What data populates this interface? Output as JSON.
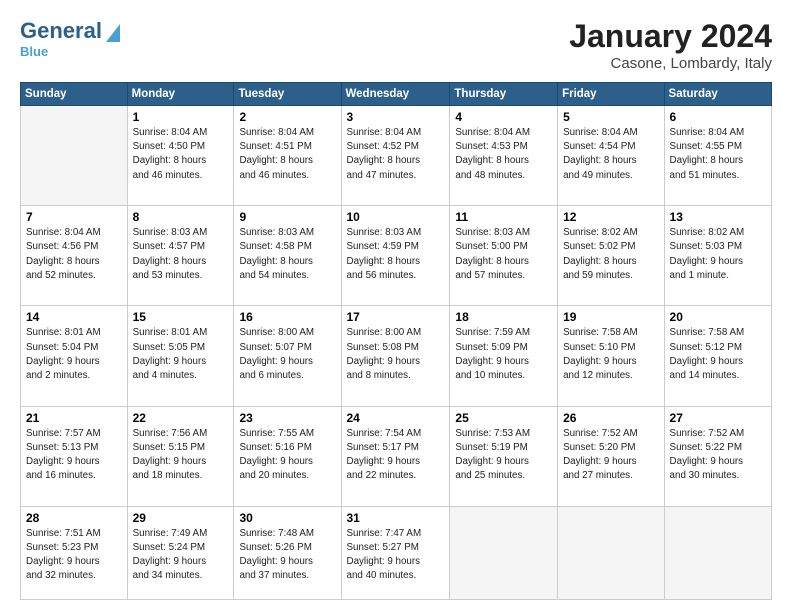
{
  "header": {
    "logo_general": "General",
    "logo_blue": "Blue",
    "title": "January 2024",
    "subtitle": "Casone, Lombardy, Italy"
  },
  "days_of_week": [
    "Sunday",
    "Monday",
    "Tuesday",
    "Wednesday",
    "Thursday",
    "Friday",
    "Saturday"
  ],
  "weeks": [
    [
      {
        "day": "",
        "info": ""
      },
      {
        "day": "1",
        "info": "Sunrise: 8:04 AM\nSunset: 4:50 PM\nDaylight: 8 hours\nand 46 minutes."
      },
      {
        "day": "2",
        "info": "Sunrise: 8:04 AM\nSunset: 4:51 PM\nDaylight: 8 hours\nand 46 minutes."
      },
      {
        "day": "3",
        "info": "Sunrise: 8:04 AM\nSunset: 4:52 PM\nDaylight: 8 hours\nand 47 minutes."
      },
      {
        "day": "4",
        "info": "Sunrise: 8:04 AM\nSunset: 4:53 PM\nDaylight: 8 hours\nand 48 minutes."
      },
      {
        "day": "5",
        "info": "Sunrise: 8:04 AM\nSunset: 4:54 PM\nDaylight: 8 hours\nand 49 minutes."
      },
      {
        "day": "6",
        "info": "Sunrise: 8:04 AM\nSunset: 4:55 PM\nDaylight: 8 hours\nand 51 minutes."
      }
    ],
    [
      {
        "day": "7",
        "info": "Sunrise: 8:04 AM\nSunset: 4:56 PM\nDaylight: 8 hours\nand 52 minutes."
      },
      {
        "day": "8",
        "info": "Sunrise: 8:03 AM\nSunset: 4:57 PM\nDaylight: 8 hours\nand 53 minutes."
      },
      {
        "day": "9",
        "info": "Sunrise: 8:03 AM\nSunset: 4:58 PM\nDaylight: 8 hours\nand 54 minutes."
      },
      {
        "day": "10",
        "info": "Sunrise: 8:03 AM\nSunset: 4:59 PM\nDaylight: 8 hours\nand 56 minutes."
      },
      {
        "day": "11",
        "info": "Sunrise: 8:03 AM\nSunset: 5:00 PM\nDaylight: 8 hours\nand 57 minutes."
      },
      {
        "day": "12",
        "info": "Sunrise: 8:02 AM\nSunset: 5:02 PM\nDaylight: 8 hours\nand 59 minutes."
      },
      {
        "day": "13",
        "info": "Sunrise: 8:02 AM\nSunset: 5:03 PM\nDaylight: 9 hours\nand 1 minute."
      }
    ],
    [
      {
        "day": "14",
        "info": "Sunrise: 8:01 AM\nSunset: 5:04 PM\nDaylight: 9 hours\nand 2 minutes."
      },
      {
        "day": "15",
        "info": "Sunrise: 8:01 AM\nSunset: 5:05 PM\nDaylight: 9 hours\nand 4 minutes."
      },
      {
        "day": "16",
        "info": "Sunrise: 8:00 AM\nSunset: 5:07 PM\nDaylight: 9 hours\nand 6 minutes."
      },
      {
        "day": "17",
        "info": "Sunrise: 8:00 AM\nSunset: 5:08 PM\nDaylight: 9 hours\nand 8 minutes."
      },
      {
        "day": "18",
        "info": "Sunrise: 7:59 AM\nSunset: 5:09 PM\nDaylight: 9 hours\nand 10 minutes."
      },
      {
        "day": "19",
        "info": "Sunrise: 7:58 AM\nSunset: 5:10 PM\nDaylight: 9 hours\nand 12 minutes."
      },
      {
        "day": "20",
        "info": "Sunrise: 7:58 AM\nSunset: 5:12 PM\nDaylight: 9 hours\nand 14 minutes."
      }
    ],
    [
      {
        "day": "21",
        "info": "Sunrise: 7:57 AM\nSunset: 5:13 PM\nDaylight: 9 hours\nand 16 minutes."
      },
      {
        "day": "22",
        "info": "Sunrise: 7:56 AM\nSunset: 5:15 PM\nDaylight: 9 hours\nand 18 minutes."
      },
      {
        "day": "23",
        "info": "Sunrise: 7:55 AM\nSunset: 5:16 PM\nDaylight: 9 hours\nand 20 minutes."
      },
      {
        "day": "24",
        "info": "Sunrise: 7:54 AM\nSunset: 5:17 PM\nDaylight: 9 hours\nand 22 minutes."
      },
      {
        "day": "25",
        "info": "Sunrise: 7:53 AM\nSunset: 5:19 PM\nDaylight: 9 hours\nand 25 minutes."
      },
      {
        "day": "26",
        "info": "Sunrise: 7:52 AM\nSunset: 5:20 PM\nDaylight: 9 hours\nand 27 minutes."
      },
      {
        "day": "27",
        "info": "Sunrise: 7:52 AM\nSunset: 5:22 PM\nDaylight: 9 hours\nand 30 minutes."
      }
    ],
    [
      {
        "day": "28",
        "info": "Sunrise: 7:51 AM\nSunset: 5:23 PM\nDaylight: 9 hours\nand 32 minutes."
      },
      {
        "day": "29",
        "info": "Sunrise: 7:49 AM\nSunset: 5:24 PM\nDaylight: 9 hours\nand 34 minutes."
      },
      {
        "day": "30",
        "info": "Sunrise: 7:48 AM\nSunset: 5:26 PM\nDaylight: 9 hours\nand 37 minutes."
      },
      {
        "day": "31",
        "info": "Sunrise: 7:47 AM\nSunset: 5:27 PM\nDaylight: 9 hours\nand 40 minutes."
      },
      {
        "day": "",
        "info": ""
      },
      {
        "day": "",
        "info": ""
      },
      {
        "day": "",
        "info": ""
      }
    ]
  ]
}
